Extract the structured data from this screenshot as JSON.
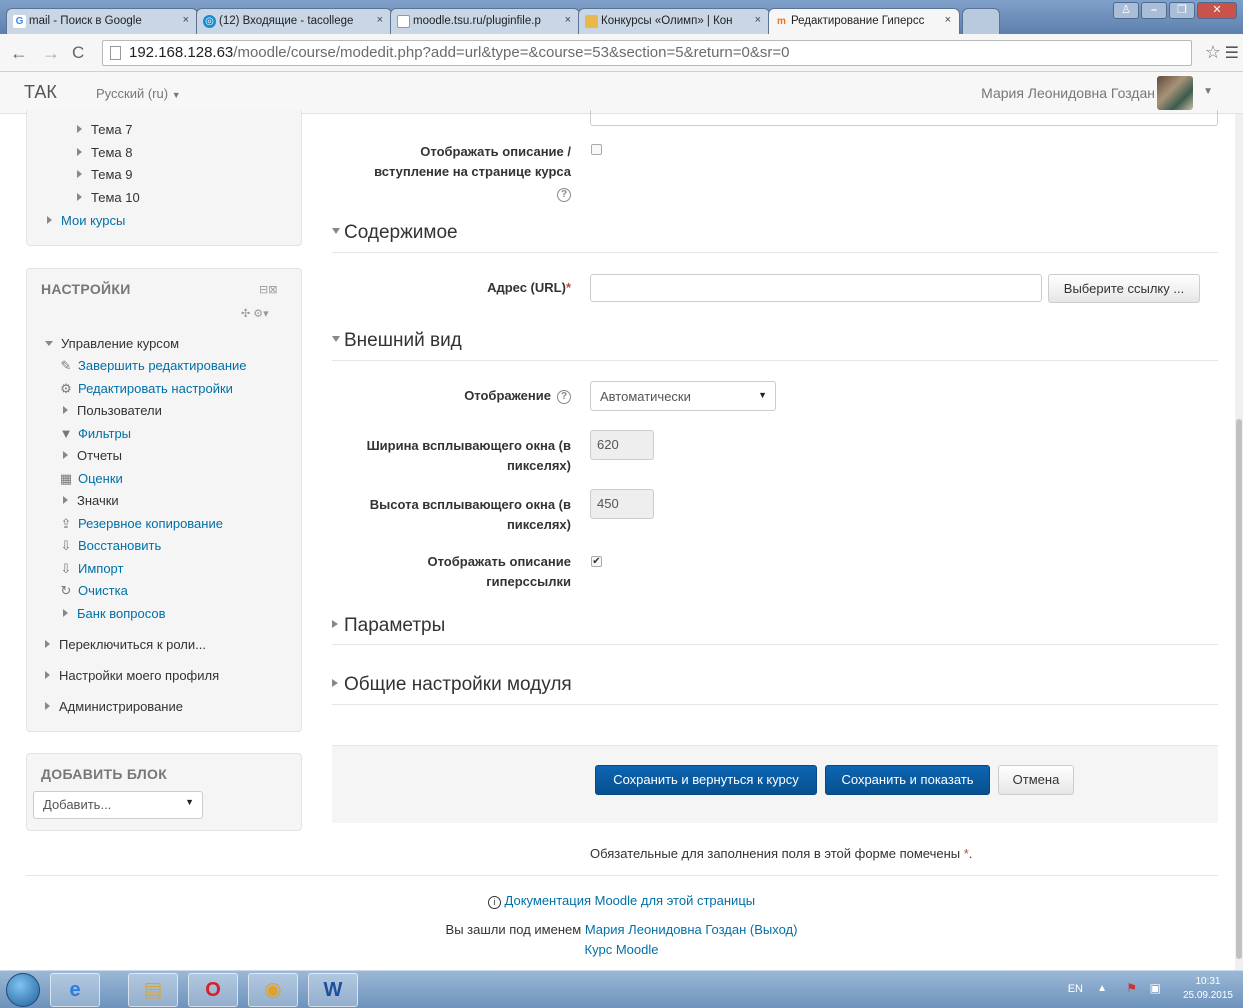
{
  "browser": {
    "tabs": [
      {
        "title": "mail - Поиск в Google",
        "favicon": "google-icon"
      },
      {
        "title": "(12) Входящие - tacollege",
        "favicon": "mail-icon"
      },
      {
        "title": "moodle.tsu.ru/pluginfile.p",
        "favicon": "page-icon"
      },
      {
        "title": "Конкурсы «Олимп» | Кон",
        "favicon": "olimp-icon"
      },
      {
        "title": "Редактирование Гиперсс",
        "favicon": "moodle-icon"
      }
    ],
    "url_host": "192.168.128.63",
    "url_path": "/moodle/course/modedit.php?add=url&type=&course=53&section=5&return=0&sr=0"
  },
  "navbar": {
    "brand": "ТАК",
    "language": "Русский (ru)",
    "user_name": "Мария Леонидовна Гоздан"
  },
  "nav_block": {
    "items": [
      "Тема 7",
      "Тема 8",
      "Тема 9",
      "Тема 10",
      "Мои курсы"
    ]
  },
  "settings_block": {
    "title": "НАСТРОЙКИ",
    "course_admin": "Управление курсом",
    "items": [
      {
        "label": "Завершить редактирование",
        "icon": "pencil-icon"
      },
      {
        "label": "Редактировать настройки",
        "icon": "gear-icon"
      },
      {
        "label": "Пользователи",
        "icon": "caret-right-icon"
      },
      {
        "label": "Фильтры",
        "icon": "filter-icon"
      },
      {
        "label": "Отчеты",
        "icon": "caret-right-icon"
      },
      {
        "label": "Оценки",
        "icon": "grades-icon"
      },
      {
        "label": "Значки",
        "icon": "caret-right-icon"
      },
      {
        "label": "Резервное копирование",
        "icon": "backup-icon"
      },
      {
        "label": "Восстановить",
        "icon": "restore-icon"
      },
      {
        "label": "Импорт",
        "icon": "import-icon"
      },
      {
        "label": "Очистка",
        "icon": "reset-icon"
      },
      {
        "label": "Банк вопросов",
        "icon": "caret-right-icon"
      }
    ],
    "switch_role": "Переключиться к роли...",
    "profile_settings": "Настройки моего профиля",
    "administration": "Администрирование"
  },
  "add_block": {
    "title": "ДОБАВИТЬ БЛОК",
    "select_value": "Добавить..."
  },
  "form": {
    "show_description_label_1": "Отображать описание /",
    "show_description_label_2": "вступление на странице курса",
    "section_content": "Содержимое",
    "url_label": "Адрес (URL)",
    "url_value": "",
    "choose_link_button": "Выберите ссылку ...",
    "section_appearance": "Внешний вид",
    "display_label": "Отображение",
    "display_value": "Автоматически",
    "popup_width_label_1": "Ширина всплывающего окна (в",
    "popup_width_label_2": "пикселях)",
    "popup_width_value": "620",
    "popup_height_label_1": "Высота всплывающего окна (в",
    "popup_height_label_2": "пикселях)",
    "popup_height_value": "450",
    "print_intro_label_1": "Отображать описание",
    "print_intro_label_2": "гиперссылки",
    "section_parameters": "Параметры",
    "section_common": "Общие настройки модуля",
    "save_return_button": "Сохранить и вернуться к курсу",
    "save_display_button": "Сохранить и показать",
    "cancel_button": "Отмена",
    "required_note": "Обязательные для заполнения поля в этой форме помечены",
    "required_mark": "*"
  },
  "footer": {
    "docs_link": "Документация Moodle для этой страницы",
    "logged_in_prefix": "Вы зашли под именем",
    "logged_in_user": "Мария Леонидовна Гоздан",
    "logout": "(Выход)",
    "course_link": "Курс Moodle"
  },
  "taskbar": {
    "lang": "EN",
    "time": "10:31",
    "date": "25.09.2015"
  },
  "colors": {
    "link": "#0070a8",
    "primary_button": "#0a5ea8",
    "required": "#b94a48"
  }
}
